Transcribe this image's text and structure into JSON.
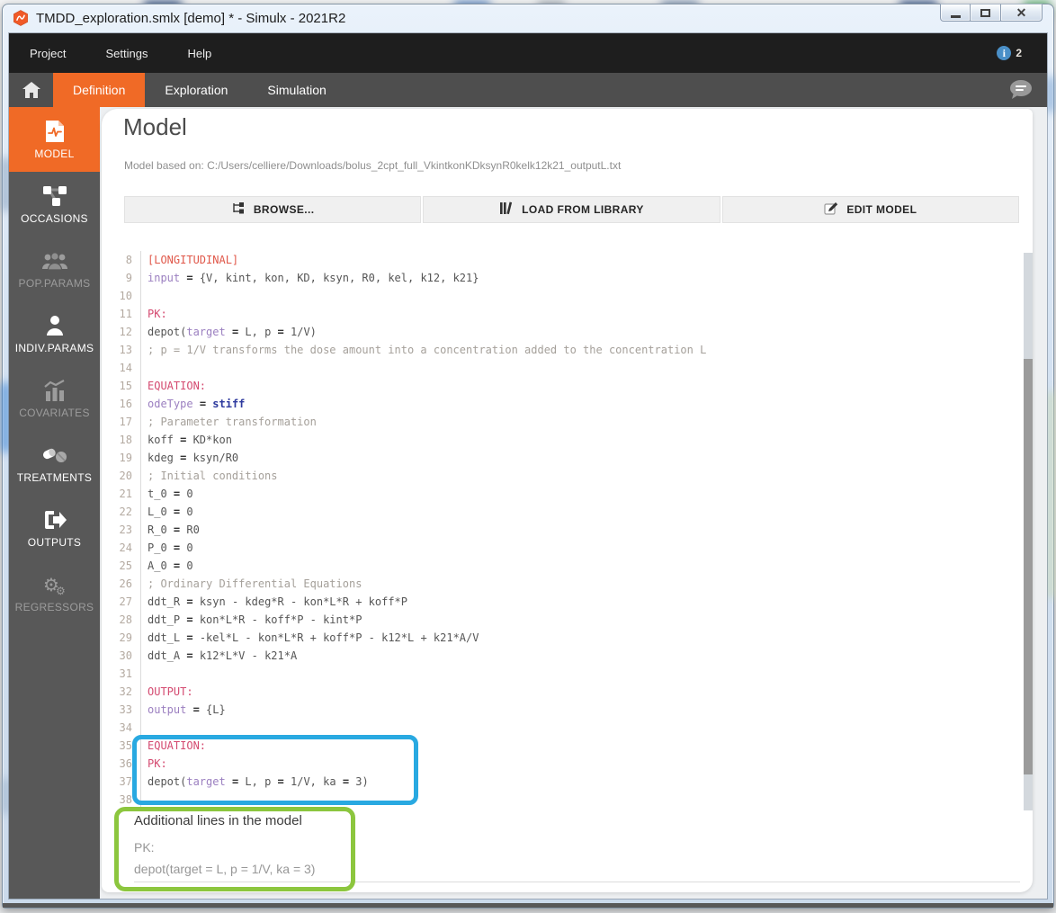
{
  "colors": {
    "accent_orange": "#f06a26",
    "highlight_blue": "#29a9e1",
    "highlight_green": "#8cc63e",
    "info_badge_blue": "#4a8fc7"
  },
  "window": {
    "title": "TMDD_exploration.smlx [demo] * - Simulx - 2021R2",
    "controls": [
      {
        "name": "minimize"
      },
      {
        "name": "maximize"
      },
      {
        "name": "close"
      }
    ]
  },
  "menu": {
    "items": [
      "Project",
      "Settings",
      "Help"
    ],
    "notification_count": "2"
  },
  "tabs": {
    "items": [
      {
        "label": "Definition",
        "active": true
      },
      {
        "label": "Exploration",
        "active": false
      },
      {
        "label": "Simulation",
        "active": false
      }
    ]
  },
  "sidebar": {
    "items": [
      {
        "label": "MODEL",
        "icon": "model-file-icon",
        "state": "active"
      },
      {
        "label": "OCCASIONS",
        "icon": "occasions-nodes-icon",
        "state": "normal"
      },
      {
        "label": "POP.PARAMS",
        "icon": "population-people-icon",
        "state": "dim"
      },
      {
        "label": "INDIV.PARAMS",
        "icon": "individual-person-icon",
        "state": "normal"
      },
      {
        "label": "COVARIATES",
        "icon": "covariates-chart-icon",
        "state": "dim"
      },
      {
        "label": "TREATMENTS",
        "icon": "treatments-pills-icon",
        "state": "normal"
      },
      {
        "label": "OUTPUTS",
        "icon": "outputs-arrow-icon",
        "state": "normal"
      },
      {
        "label": "REGRESSORS",
        "icon": "regressors-gears-icon",
        "state": "dim"
      }
    ]
  },
  "model_page": {
    "title": "Model",
    "based_on": "Model based on: C:/Users/celliere/Downloads/bolus_2cpt_full_VkintkonKDksynR0kelk12k21_outputL.txt",
    "buttons": [
      {
        "label": "BROWSE...",
        "icon": "browse-tree-icon"
      },
      {
        "label": "LOAD FROM LIBRARY",
        "icon": "library-books-icon"
      },
      {
        "label": "EDIT MODEL",
        "icon": "edit-pencil-icon"
      }
    ],
    "editor": {
      "lines": [
        {
          "n": 8,
          "tokens": [
            [
              "[LONGITUDINAL]",
              "sec"
            ]
          ]
        },
        {
          "n": 9,
          "tokens": [
            [
              "input",
              "kw"
            ],
            [
              " ",
              "code"
            ],
            [
              "=",
              "op"
            ],
            [
              " {V, kint, kon, KD, ksyn, R0, kel, k12, k21}",
              "code"
            ]
          ]
        },
        {
          "n": 10,
          "tokens": []
        },
        {
          "n": 11,
          "tokens": [
            [
              "PK:",
              "lbl"
            ]
          ]
        },
        {
          "n": 12,
          "tokens": [
            [
              "depot(",
              "code"
            ],
            [
              "target",
              "kw"
            ],
            [
              " ",
              "code"
            ],
            [
              "=",
              "op"
            ],
            [
              " L, p ",
              "code"
            ],
            [
              "=",
              "op"
            ],
            [
              " 1/V)",
              "code"
            ]
          ]
        },
        {
          "n": 13,
          "tokens": [
            [
              "; p = 1/V transforms the dose amount into a concentration added to the concentration L",
              "com"
            ]
          ]
        },
        {
          "n": 14,
          "tokens": []
        },
        {
          "n": 15,
          "tokens": [
            [
              "EQUATION:",
              "lbl"
            ]
          ]
        },
        {
          "n": 16,
          "tokens": [
            [
              "odeType",
              "kw"
            ],
            [
              " ",
              "code"
            ],
            [
              "=",
              "op"
            ],
            [
              " ",
              "code"
            ],
            [
              "stiff",
              "const"
            ]
          ]
        },
        {
          "n": 17,
          "tokens": [
            [
              "; Parameter transformation",
              "com"
            ]
          ]
        },
        {
          "n": 18,
          "tokens": [
            [
              "koff ",
              "code"
            ],
            [
              "=",
              "op"
            ],
            [
              " KD*kon",
              "code"
            ]
          ]
        },
        {
          "n": 19,
          "tokens": [
            [
              "kdeg ",
              "code"
            ],
            [
              "=",
              "op"
            ],
            [
              " ksyn/R0",
              "code"
            ]
          ]
        },
        {
          "n": 20,
          "tokens": [
            [
              "; Initial conditions",
              "com"
            ]
          ]
        },
        {
          "n": 21,
          "tokens": [
            [
              "t_0 ",
              "code"
            ],
            [
              "=",
              "op"
            ],
            [
              " 0",
              "code"
            ]
          ]
        },
        {
          "n": 22,
          "tokens": [
            [
              "L_0 ",
              "code"
            ],
            [
              "=",
              "op"
            ],
            [
              " 0",
              "code"
            ]
          ]
        },
        {
          "n": 23,
          "tokens": [
            [
              "R_0 ",
              "code"
            ],
            [
              "=",
              "op"
            ],
            [
              " R0",
              "code"
            ]
          ]
        },
        {
          "n": 24,
          "tokens": [
            [
              "P_0 ",
              "code"
            ],
            [
              "=",
              "op"
            ],
            [
              " 0",
              "code"
            ]
          ]
        },
        {
          "n": 25,
          "tokens": [
            [
              "A_0 ",
              "code"
            ],
            [
              "=",
              "op"
            ],
            [
              " 0",
              "code"
            ]
          ]
        },
        {
          "n": 26,
          "tokens": [
            [
              "; Ordinary Differential Equations",
              "com"
            ]
          ]
        },
        {
          "n": 27,
          "tokens": [
            [
              "ddt_R ",
              "code"
            ],
            [
              "=",
              "op"
            ],
            [
              " ksyn - kdeg*R - kon*L*R + koff*P",
              "code"
            ]
          ]
        },
        {
          "n": 28,
          "tokens": [
            [
              "ddt_P ",
              "code"
            ],
            [
              "=",
              "op"
            ],
            [
              " kon*L*R - koff*P - kint*P",
              "code"
            ]
          ]
        },
        {
          "n": 29,
          "tokens": [
            [
              "ddt_L ",
              "code"
            ],
            [
              "=",
              "op"
            ],
            [
              " -kel*L - kon*L*R + koff*P - k12*L + k21*A/V",
              "code"
            ]
          ]
        },
        {
          "n": 30,
          "tokens": [
            [
              "ddt_A ",
              "code"
            ],
            [
              "=",
              "op"
            ],
            [
              " k12*L*V - k21*A",
              "code"
            ]
          ]
        },
        {
          "n": 31,
          "tokens": []
        },
        {
          "n": 32,
          "tokens": [
            [
              "OUTPUT:",
              "lbl"
            ]
          ]
        },
        {
          "n": 33,
          "tokens": [
            [
              "output",
              "kw"
            ],
            [
              " ",
              "code"
            ],
            [
              "=",
              "op"
            ],
            [
              " {L}",
              "code"
            ]
          ]
        },
        {
          "n": 34,
          "tokens": []
        },
        {
          "n": 35,
          "tokens": [
            [
              "EQUATION:",
              "lbl"
            ]
          ]
        },
        {
          "n": 36,
          "tokens": [
            [
              "PK:",
              "lbl"
            ]
          ]
        },
        {
          "n": 37,
          "tokens": [
            [
              "depot(",
              "code"
            ],
            [
              "target",
              "kw"
            ],
            [
              " ",
              "code"
            ],
            [
              "=",
              "op"
            ],
            [
              " L, p ",
              "code"
            ],
            [
              "=",
              "op"
            ],
            [
              " 1/V, ka ",
              "code"
            ],
            [
              "=",
              "op"
            ],
            [
              " 3)",
              "code"
            ]
          ]
        },
        {
          "n": 38,
          "tokens": []
        }
      ]
    },
    "highlight_note": {
      "title": "Additional lines in the model",
      "lines": [
        "PK:",
        "depot(target = L, p = 1/V, ka = 3)"
      ]
    }
  }
}
